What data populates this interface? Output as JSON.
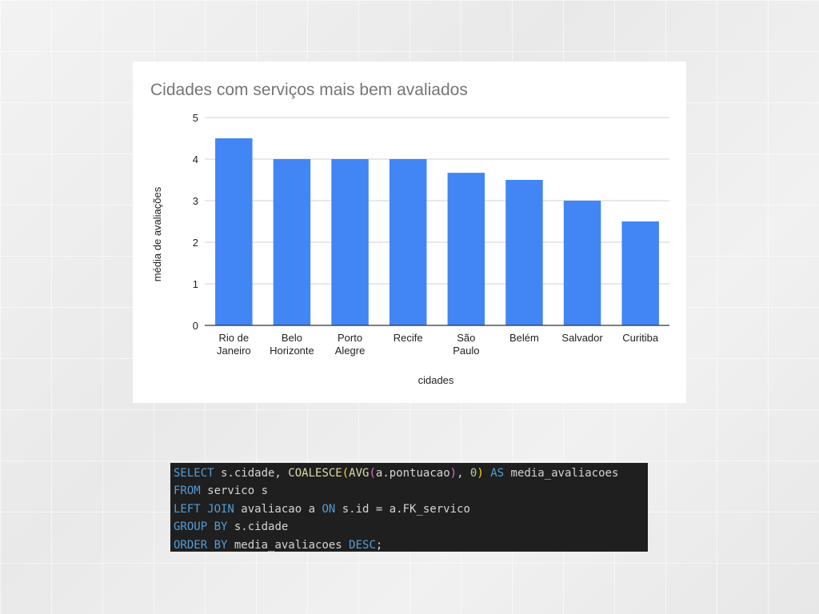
{
  "chart_data": {
    "type": "bar",
    "title": "Cidades com serviços mais bem avaliados",
    "xlabel": "cidades",
    "ylabel": "média de avaliações",
    "ylim": [
      0,
      5
    ],
    "yticks": [
      0,
      1,
      2,
      3,
      4,
      5
    ],
    "grid": true,
    "legend": "none",
    "bar_color": "#4285f4",
    "categories": [
      [
        "Rio de",
        "Janeiro"
      ],
      [
        "Belo",
        "Horizonte"
      ],
      [
        "Porto",
        "Alegre"
      ],
      [
        "Recife"
      ],
      [
        "São",
        "Paulo"
      ],
      [
        "Belém"
      ],
      [
        "Salvador"
      ],
      [
        "Curitiba"
      ]
    ],
    "values": [
      4.5,
      4.0,
      4.0,
      4.0,
      3.67,
      3.5,
      3.0,
      2.5
    ]
  },
  "code": {
    "lines": [
      [
        {
          "t": "SELECT",
          "c": "kw"
        },
        {
          "t": " s.cidade, ",
          "c": "plain"
        },
        {
          "t": "COALESCE",
          "c": "fn"
        },
        {
          "t": "(",
          "c": "p1"
        },
        {
          "t": "AVG",
          "c": "fn"
        },
        {
          "t": "(",
          "c": "p2"
        },
        {
          "t": "a.pontuacao",
          "c": "plain"
        },
        {
          "t": ")",
          "c": "p2"
        },
        {
          "t": ", ",
          "c": "plain"
        },
        {
          "t": "0",
          "c": "num"
        },
        {
          "t": ")",
          "c": "p1"
        },
        {
          "t": " ",
          "c": "plain"
        },
        {
          "t": "AS",
          "c": "kw"
        },
        {
          "t": " media_avaliacoes",
          "c": "plain"
        }
      ],
      [
        {
          "t": "FROM",
          "c": "kw"
        },
        {
          "t": " servico s",
          "c": "plain"
        }
      ],
      [
        {
          "t": "LEFT JOIN",
          "c": "kw"
        },
        {
          "t": " avaliacao a ",
          "c": "plain"
        },
        {
          "t": "ON",
          "c": "kw"
        },
        {
          "t": " s.id = a.FK_servico",
          "c": "plain"
        }
      ],
      [
        {
          "t": "GROUP BY",
          "c": "kw"
        },
        {
          "t": " s.cidade",
          "c": "plain"
        }
      ],
      [
        {
          "t": "ORDER BY",
          "c": "kw"
        },
        {
          "t": " media_avaliacoes ",
          "c": "plain"
        },
        {
          "t": "DESC",
          "c": "kw"
        },
        {
          "t": ";",
          "c": "plain"
        }
      ]
    ]
  }
}
